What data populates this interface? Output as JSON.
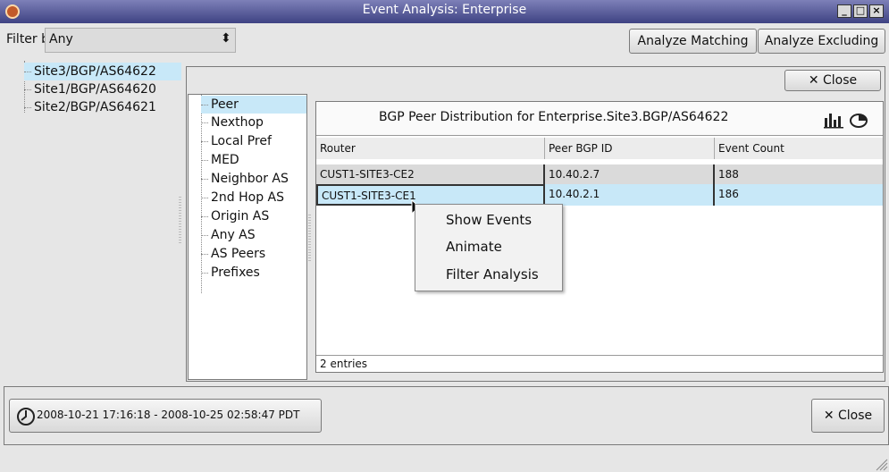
{
  "window": {
    "title": "Event Analysis: Enterprise"
  },
  "toolbar": {
    "filter_label": "Filter by:",
    "filter_value": "Any",
    "analyze_matching": "Analyze Matching",
    "analyze_excluding": "Analyze Excluding"
  },
  "sites": [
    "Site3/BGP/AS64622",
    "Site1/BGP/AS64620",
    "Site2/BGP/AS64621"
  ],
  "close_label": "Close",
  "categories": [
    "Peer",
    "Nexthop",
    "Local Pref",
    "MED",
    "Neighbor AS",
    "2nd Hop AS",
    "Origin AS",
    "Any AS",
    "AS Peers",
    "Prefixes"
  ],
  "table": {
    "title": "BGP Peer Distribution for Enterprise.Site3.BGP/AS64622",
    "columns": [
      "Router",
      "Peer BGP ID",
      "Event Count"
    ],
    "rows": [
      {
        "router": "CUST1-SITE3-CE2",
        "peer": "10.40.2.7",
        "count": "188"
      },
      {
        "router": "CUST1-SITE3-CE1",
        "peer": "10.40.2.1",
        "count": "186"
      }
    ],
    "footer": "2 entries"
  },
  "context_menu": [
    "Show Events",
    "Animate",
    "Filter Analysis"
  ],
  "time_range": "2008-10-21 17:16:18 - 2008-10-25 02:58:47 PDT",
  "colors": {
    "selection": "#c8e8f8",
    "titlebar": "#3e4283"
  }
}
